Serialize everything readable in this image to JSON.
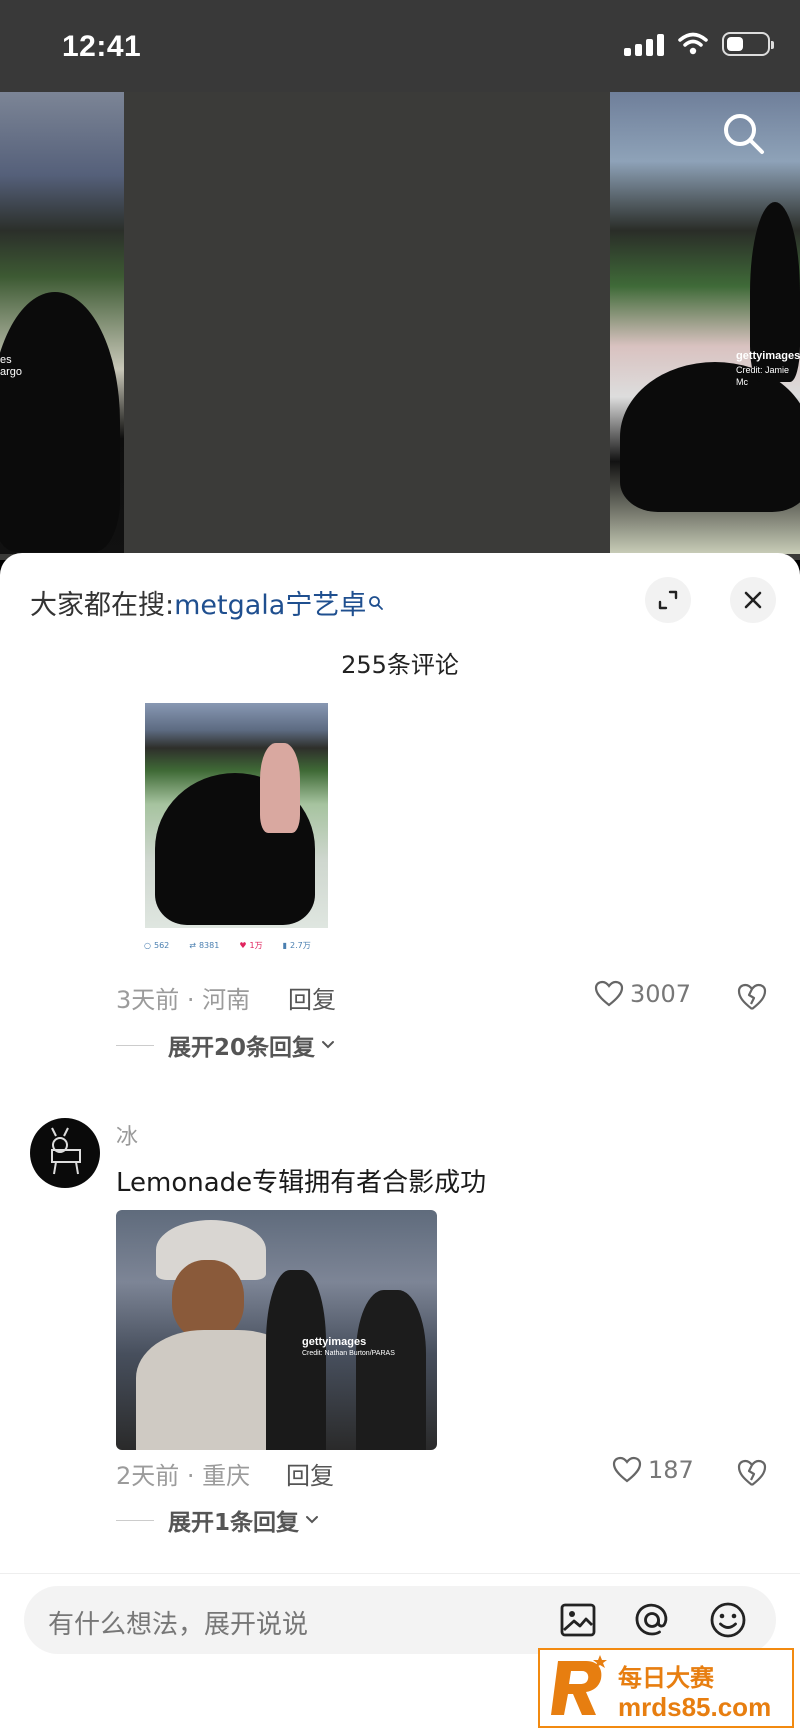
{
  "status_bar": {
    "time": "12:41"
  },
  "video": {
    "left_credit": "es\nargo",
    "right_credit_brand": "gettyimages",
    "right_credit": "Credit: Jamie Mc"
  },
  "sheet": {
    "hot_search_prefix": "大家都在搜:",
    "hot_search_term": "metgala宁艺卓",
    "comment_count": "255条评论"
  },
  "comments": [
    {
      "image_stats": [
        "562",
        "8381",
        "1万",
        "2.7万"
      ],
      "time_location": "3天前 · 河南",
      "reply_label": "回复",
      "likes": "3007",
      "expand_label": "展开20条回复"
    },
    {
      "username": "冰",
      "text": "Lemonade专辑拥有者合影成功",
      "image_credit_brand": "gettyimages",
      "image_credit": "Credit: Nathan Burton/PARAS",
      "time_location": "2天前 · 重庆",
      "reply_label": "回复",
      "likes": "187",
      "expand_label": "展开1条回复"
    }
  ],
  "input": {
    "placeholder": "有什么想法，展开说说"
  },
  "watermark": {
    "line1": "每日大赛",
    "line2": "mrds85.com"
  },
  "colors": {
    "link_blue": "#1f4f8f",
    "watermark_orange": "#e77e10"
  }
}
